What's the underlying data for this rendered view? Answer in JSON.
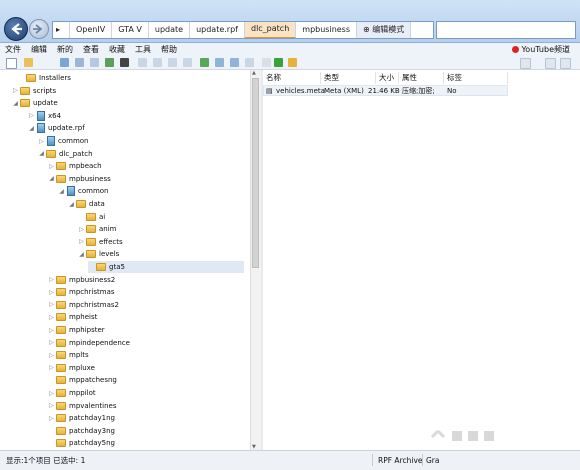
{
  "breadcrumb": {
    "items": [
      "OpenIV",
      "GTA V",
      "update",
      "update.rpf",
      "dlc_patch",
      "mpbusiness"
    ],
    "edit_mode": "编辑模式"
  },
  "menu": {
    "items": [
      "文件",
      "编辑",
      "新的",
      "查看",
      "收藏",
      "工具",
      "帮助"
    ],
    "youtube": "YouTube频道"
  },
  "tree": {
    "items": [
      {
        "label": "Installers",
        "type": "folder",
        "arrow": ""
      },
      {
        "label": "scripts",
        "type": "folder",
        "arrow": "▷"
      },
      {
        "label": "update",
        "type": "folder",
        "arrow": "◢"
      },
      {
        "label": "x64",
        "type": "rpf",
        "arrow": "▷"
      },
      {
        "label": "update.rpf",
        "type": "rpf",
        "arrow": "◢"
      },
      {
        "label": "common",
        "type": "rpf",
        "arrow": "▷"
      },
      {
        "label": "dlc_patch",
        "type": "folder",
        "arrow": "◢"
      },
      {
        "label": "mpbeach",
        "type": "folder",
        "arrow": "▷"
      },
      {
        "label": "mpbusiness",
        "type": "folder",
        "arrow": "◢"
      },
      {
        "label": "common",
        "type": "rpf",
        "arrow": "◢"
      },
      {
        "label": "data",
        "type": "folder",
        "arrow": "◢"
      },
      {
        "label": "ai",
        "type": "folder",
        "arrow": ""
      },
      {
        "label": "anim",
        "type": "folder",
        "arrow": "▷"
      },
      {
        "label": "effects",
        "type": "folder",
        "arrow": "▷"
      },
      {
        "label": "levels",
        "type": "folder",
        "arrow": "◢"
      },
      {
        "label": "gta5",
        "type": "folder",
        "arrow": ""
      },
      {
        "label": "mpbusiness2",
        "type": "folder",
        "arrow": "▷"
      },
      {
        "label": "mpchristmas",
        "type": "folder",
        "arrow": "▷"
      },
      {
        "label": "mpchristmas2",
        "type": "folder",
        "arrow": "▷"
      },
      {
        "label": "mpheist",
        "type": "folder",
        "arrow": "▷"
      },
      {
        "label": "mphipster",
        "type": "folder",
        "arrow": "▷"
      },
      {
        "label": "mpindependence",
        "type": "folder",
        "arrow": "▷"
      },
      {
        "label": "mplts",
        "type": "folder",
        "arrow": "▷"
      },
      {
        "label": "mpluxe",
        "type": "folder",
        "arrow": "▷"
      },
      {
        "label": "mppatchesng",
        "type": "folder",
        "arrow": ""
      },
      {
        "label": "mppilot",
        "type": "folder",
        "arrow": "▷"
      },
      {
        "label": "mpvalentines",
        "type": "folder",
        "arrow": "▷"
      },
      {
        "label": "patchday1ng",
        "type": "folder",
        "arrow": "▷"
      },
      {
        "label": "patchday3ng",
        "type": "folder",
        "arrow": ""
      },
      {
        "label": "patchday5ng",
        "type": "folder",
        "arrow": ""
      }
    ],
    "selected": "gta5"
  },
  "file_list": {
    "columns": [
      "名称",
      "类型",
      "大小",
      "属性",
      "标签"
    ],
    "rows": [
      {
        "name": "vehicles.meta",
        "type": "Meta (XML)",
        "size": "21.46 KB",
        "attributes": "压缩;加密;",
        "tags": "No"
      }
    ]
  },
  "status": {
    "summary": "显示:1个项目  已选中: 1",
    "archive": "RPF Archive",
    "extra": "Gra"
  },
  "colors": {
    "titlebar": "#c6dcf2",
    "active_crumb": "#e0963c",
    "row_selected": "#eef3fa"
  }
}
